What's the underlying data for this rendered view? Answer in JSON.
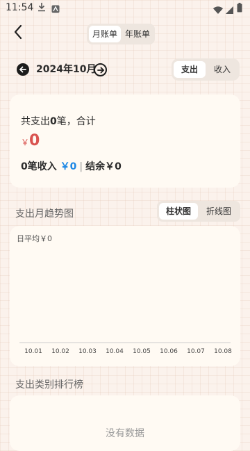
{
  "status_bar": {
    "time": "11:54"
  },
  "header": {
    "tabs": [
      "月账单",
      "年账单"
    ],
    "active_tab": 0
  },
  "period": {
    "month_label": "2024年10月",
    "type_tabs": [
      "支出",
      "收入"
    ],
    "active_type": 0
  },
  "summary": {
    "prefix": "共支出",
    "count": "0",
    "suffix": "笔，合计",
    "currency": "￥",
    "amount": "0",
    "income_count_text": "0笔收入",
    "income_amount_text": "￥0",
    "balance_text": "结余￥0"
  },
  "trend": {
    "title": "支出月趋势图",
    "chart_tabs": [
      "柱状图",
      "折线图"
    ],
    "active_chart_tab": 0,
    "avg_label": "日平均￥0"
  },
  "chart_data": {
    "type": "bar",
    "categories": [
      "10.01",
      "10.02",
      "10.03",
      "10.04",
      "10.05",
      "10.06",
      "10.07",
      "10.08"
    ],
    "values": [
      0,
      0,
      0,
      0,
      0,
      0,
      0,
      0
    ],
    "title": "",
    "xlabel": "",
    "ylabel": ""
  },
  "ranking": {
    "title": "支出类别排行榜",
    "empty_text": "没有数据"
  }
}
